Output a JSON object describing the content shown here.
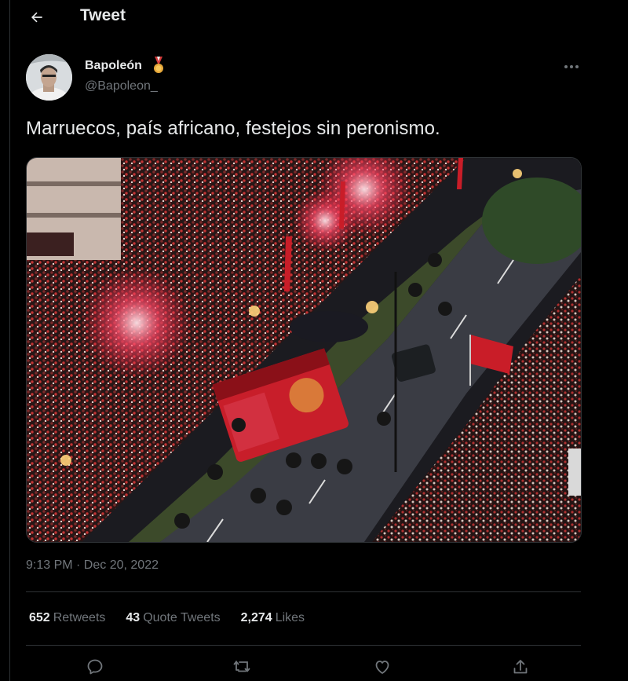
{
  "header": {
    "title": "Tweet"
  },
  "author": {
    "name": "Bapoleón",
    "handle": "@Bapoleon_"
  },
  "tweet": {
    "text": "Marruecos, país africano, festejos sin peronismo.",
    "timestamp": "9:13 PM · Dec 20, 2022"
  },
  "stats": {
    "retweets_count": "652",
    "retweets_label": "Retweets",
    "quotes_count": "43",
    "quotes_label": "Quote Tweets",
    "likes_count": "2,274",
    "likes_label": "Likes"
  },
  "icons": {
    "back": "arrow-left-icon",
    "medal": "medal-icon",
    "more": "more-icon",
    "reply": "reply-icon",
    "retweet": "retweet-icon",
    "like": "heart-icon",
    "share": "share-icon"
  },
  "colors": {
    "background": "#000000",
    "text": "#e7e9ea",
    "secondary": "#71767b",
    "border": "#2f3336"
  }
}
